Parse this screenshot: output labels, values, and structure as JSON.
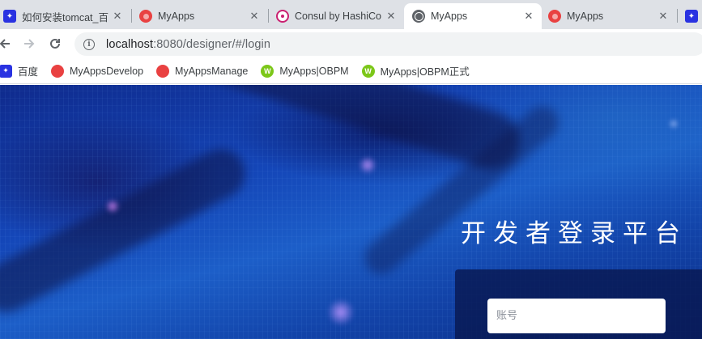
{
  "tabs": [
    {
      "title": "如何安装tomcat_百",
      "icon": "baidu-paw-icon"
    },
    {
      "title": "MyApps",
      "icon": "myapps-icon"
    },
    {
      "title": "Consul by HashiCo",
      "icon": "consul-icon"
    },
    {
      "title": "MyApps",
      "icon": "globe-icon",
      "active": true
    },
    {
      "title": "MyApps",
      "icon": "myapps-icon"
    }
  ],
  "toolbar": {
    "url_host": "localhost",
    "url_rest": ":8080/designer/#/login"
  },
  "bookmarks": [
    {
      "label": "百度",
      "icon": "baidu-paw-icon"
    },
    {
      "label": "MyAppsDevelop",
      "icon": "myapps-icon"
    },
    {
      "label": "MyAppsManage",
      "icon": "myapps-icon"
    },
    {
      "label": "MyApps|OBPM",
      "icon": "w-logo-icon"
    },
    {
      "label": "MyApps|OBPM正式",
      "icon": "w-logo-icon"
    }
  ],
  "page": {
    "title": "开发者登录平台",
    "account_placeholder": "账号"
  },
  "colors": {
    "tabstrip": "#dee1e6",
    "background_blue": "#1446b8",
    "panel": "#081852"
  }
}
